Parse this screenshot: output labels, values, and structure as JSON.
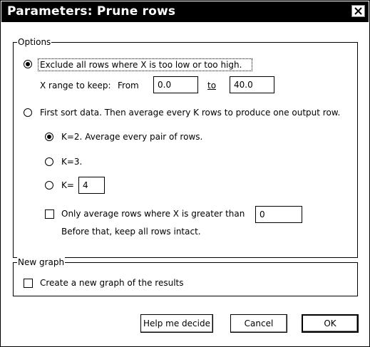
{
  "window": {
    "title": "Parameters: Prune rows"
  },
  "options_group": {
    "legend": "Options",
    "exclude_option": {
      "selected": true,
      "label": "Exclude all rows where X  is too low or too high.",
      "range_label": "X range to keep:",
      "from_label": "From",
      "from_value": "0.0",
      "to_label": "to",
      "to_value": "40.0"
    },
    "average_option": {
      "selected": false,
      "label": "First sort data. Then average every K rows to produce one output row.",
      "k2_label": "K=2. Average every pair of rows.",
      "k2_selected": true,
      "k3_label": "K=3.",
      "k3_selected": false,
      "kcustom_label": "K=",
      "kcustom_selected": false,
      "kcustom_value": "4",
      "only_avg_checked": false,
      "only_avg_label": "Only average rows where X is greater than",
      "only_avg_value": "0",
      "only_avg_note": "Before that, keep all rows intact."
    }
  },
  "graph_group": {
    "legend": "New graph",
    "create_checked": false,
    "create_label": "Create a new graph of the results"
  },
  "buttons": {
    "help": "Help me decide",
    "cancel": "Cancel",
    "ok": "OK"
  }
}
